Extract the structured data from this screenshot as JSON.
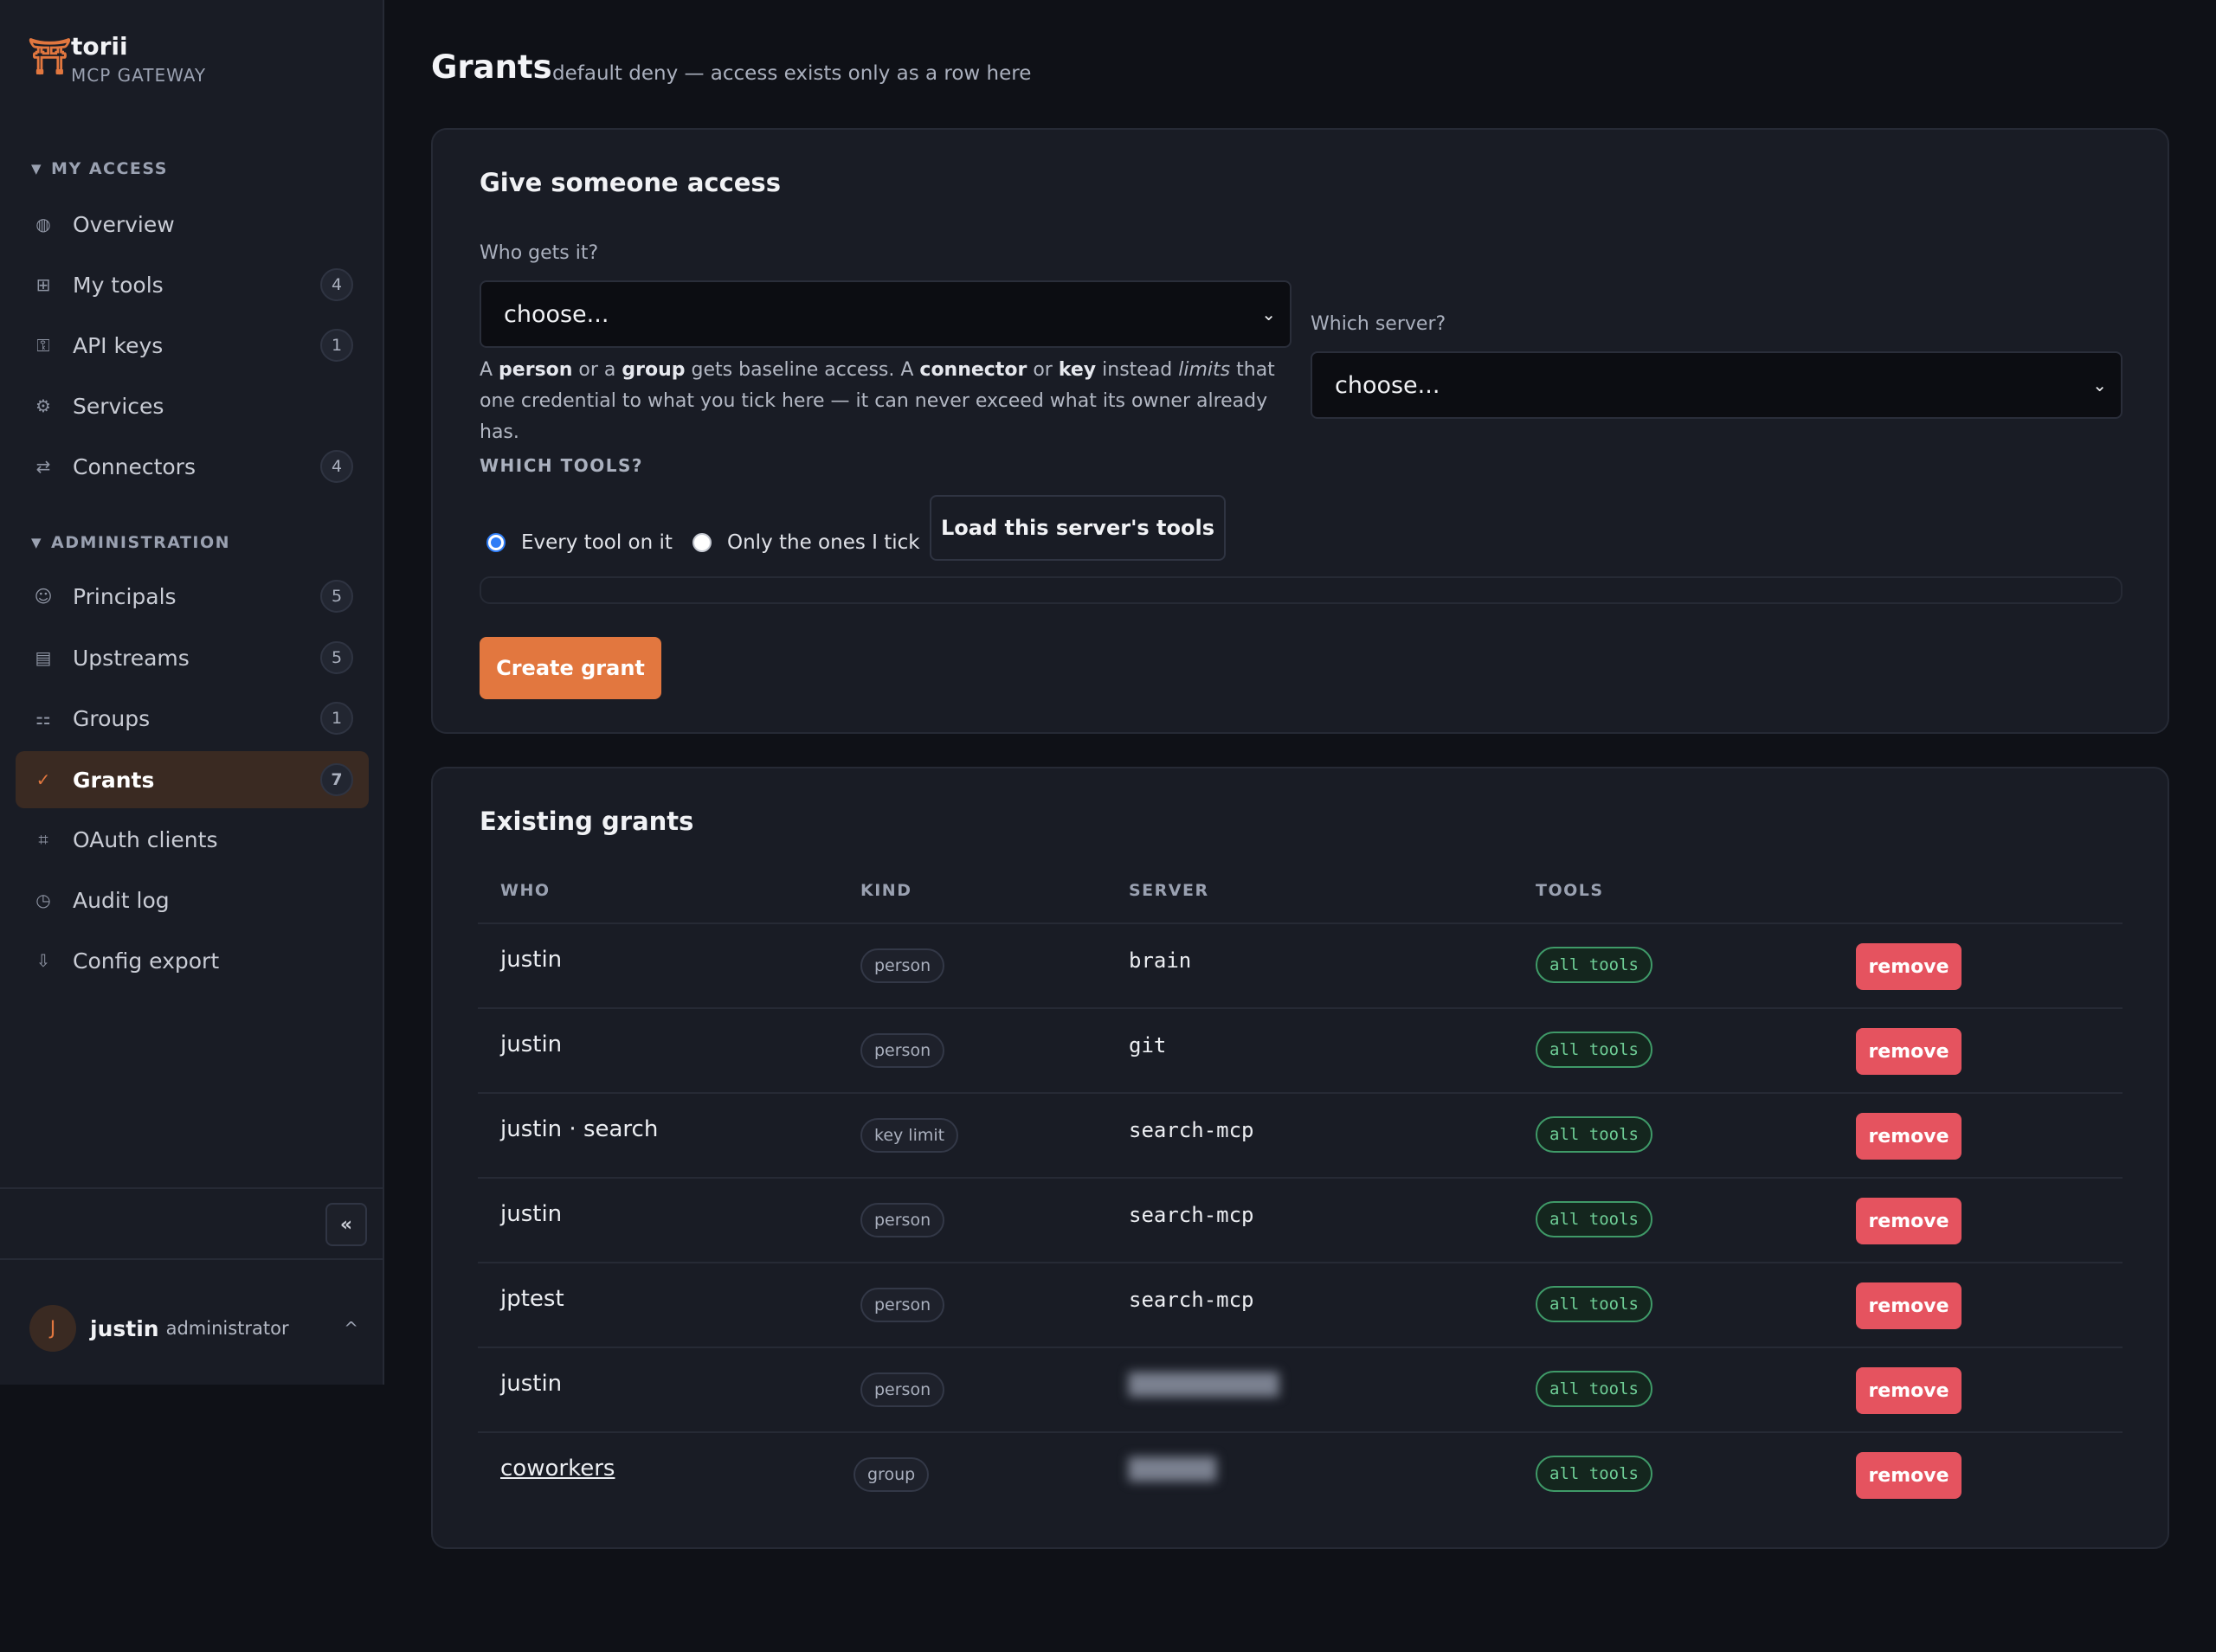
{
  "brand": {
    "name": "torii",
    "subtitle": "MCP GATEWAY",
    "logo_icon": "torii-gate-icon",
    "logo_glyph": "⛩"
  },
  "sidebar": {
    "sections": [
      {
        "title": "MY ACCESS"
      },
      {
        "title": "ADMINISTRATION"
      }
    ],
    "items": [
      {
        "label": "Overview",
        "icon": "globe-icon",
        "glyph": "◍",
        "count": ""
      },
      {
        "label": "My tools",
        "icon": "grid-icon",
        "glyph": "⊞",
        "count": "4"
      },
      {
        "label": "API keys",
        "icon": "key-icon",
        "glyph": "⚿",
        "count": "1"
      },
      {
        "label": "Services",
        "icon": "gear-icon",
        "glyph": "⚙",
        "count": ""
      },
      {
        "label": "Connectors",
        "icon": "swap-icon",
        "glyph": "⇄",
        "count": "4"
      },
      {
        "label": "Principals",
        "icon": "smile-icon",
        "glyph": "☺",
        "count": "5"
      },
      {
        "label": "Upstreams",
        "icon": "server-icon",
        "glyph": "▤",
        "count": "5"
      },
      {
        "label": "Groups",
        "icon": "group-icon",
        "glyph": "⚏",
        "count": "1"
      },
      {
        "label": "Grants",
        "icon": "check-icon",
        "glyph": "✓",
        "count": "7"
      },
      {
        "label": "OAuth clients",
        "icon": "hash-icon",
        "glyph": "⌗",
        "count": ""
      },
      {
        "label": "Audit log",
        "icon": "clock-icon",
        "glyph": "◷",
        "count": ""
      },
      {
        "label": "Config export",
        "icon": "download-icon",
        "glyph": "⇩",
        "count": ""
      }
    ],
    "collapse_label": "«",
    "user": {
      "initial": "J",
      "name": "justin",
      "role": "administrator",
      "caret": "^"
    }
  },
  "page": {
    "title": "Grants",
    "subtitle": "default deny — access exists only as a row here"
  },
  "form": {
    "title": "Give someone access",
    "who_label": "Who gets it?",
    "who_value": "choose...",
    "server_label": "Which server?",
    "server_value": "choose...",
    "help": {
      "p1": "A ",
      "b1": "person",
      "p2": " or a ",
      "b2": "group",
      "p3": " gets baseline access. A ",
      "b3": "connector",
      "p4": " or ",
      "b4": "key",
      "p5": " instead ",
      "i1": "limits",
      "p6": " that one credential to what you tick here — it can never exceed what its owner already has."
    },
    "which_tools_label": "WHICH TOOLS?",
    "radio_all": "Every tool on it",
    "radio_some": "Only the ones I tick",
    "load_button": "Load this server's tools",
    "create_button": "Create grant"
  },
  "grants": {
    "title": "Existing grants",
    "headers": [
      "WHO",
      "KIND",
      "SERVER",
      "TOOLS"
    ],
    "remove_label": "remove",
    "rows": [
      {
        "who": "justin",
        "kind": "person",
        "server": "brain",
        "tools": "all tools"
      },
      {
        "who": "justin",
        "kind": "person",
        "server": "git",
        "tools": "all tools"
      },
      {
        "who": "justin · search",
        "kind": "key limit",
        "server": "search-mcp",
        "tools": "all tools"
      },
      {
        "who": "justin",
        "kind": "person",
        "server": "search-mcp",
        "tools": "all tools"
      },
      {
        "who": "jptest",
        "kind": "person",
        "server": "search-mcp",
        "tools": "all tools"
      },
      {
        "who": "justin",
        "kind": "person",
        "server": "",
        "tools": "all tools"
      },
      {
        "who": "coworkers",
        "kind": "group",
        "server": "",
        "tools": "all tools"
      }
    ]
  },
  "colors": {
    "accent": "#e2773f",
    "danger": "#e5535f",
    "success": "#6fcf97",
    "bg": "#0f1117",
    "panel": "#191c25"
  }
}
